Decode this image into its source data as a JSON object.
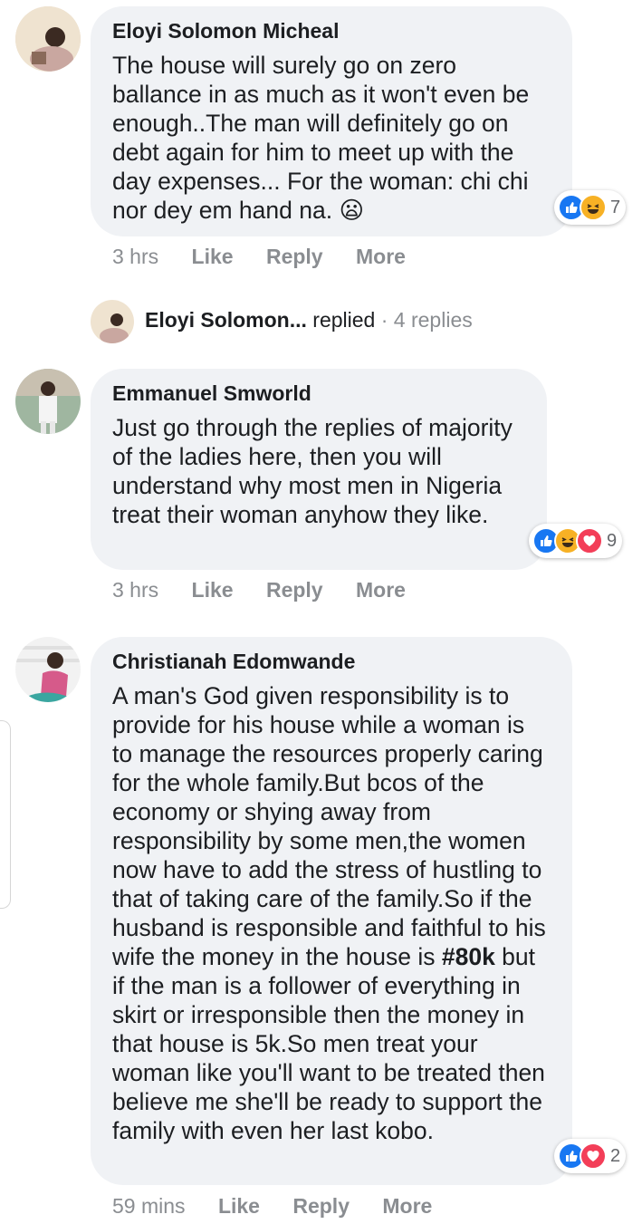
{
  "comments": [
    {
      "author": "Eloyi Solomon Micheal",
      "text": "The house will surely go on zero ballance in as much as it won't even be enough..The man will definitely go on debt again for him to meet up with the day expenses... For the woman: chi chi nor dey em hand na. ",
      "emoji": "😦",
      "reactions": [
        "like",
        "haha"
      ],
      "reaction_count": "7",
      "time": "3 hrs",
      "actions": [
        "Like",
        "Reply",
        "More"
      ]
    },
    {
      "author": "Emmanuel Smworld",
      "text": "Just go through the replies of majority of the ladies here, then you will understand why most men in Nigeria treat their woman anyhow they like.",
      "reactions": [
        "like",
        "haha",
        "love"
      ],
      "reaction_count": "9",
      "time": "3 hrs",
      "actions": [
        "Like",
        "Reply",
        "More"
      ]
    },
    {
      "author": "Christianah Edomwande",
      "text_before": "A man's God given responsibility is to provide for his house while a woman is to manage the resources properly caring for the whole family.But bcos of the economy or shying away from responsibility by some men,the women now have to add the stress of hustling to that of taking care of the family.So if the husband is responsible and faithful to his wife the money in the house is ",
      "text_bold": "#80k",
      "text_after": " but if the man is a follower of everything in skirt or irresponsible then the money in that house is 5k.So men treat your woman like you'll want to be treated then believe me she'll be ready to support the family with even her last kobo.",
      "reactions": [
        "like",
        "love"
      ],
      "reaction_count": "2",
      "time": "59 mins",
      "actions": [
        "Like",
        "Reply",
        "More"
      ]
    }
  ],
  "reply_summary": {
    "author": "Eloyi Solomon...",
    "verb": "replied",
    "separator": "·",
    "count": "4 replies"
  },
  "colors": {
    "bubble": "#f0f2f5",
    "like_blue": "#1877f2",
    "love_red": "#f33e58",
    "haha_yellow": "#f7b125",
    "meta_gray": "#8a8d91"
  }
}
